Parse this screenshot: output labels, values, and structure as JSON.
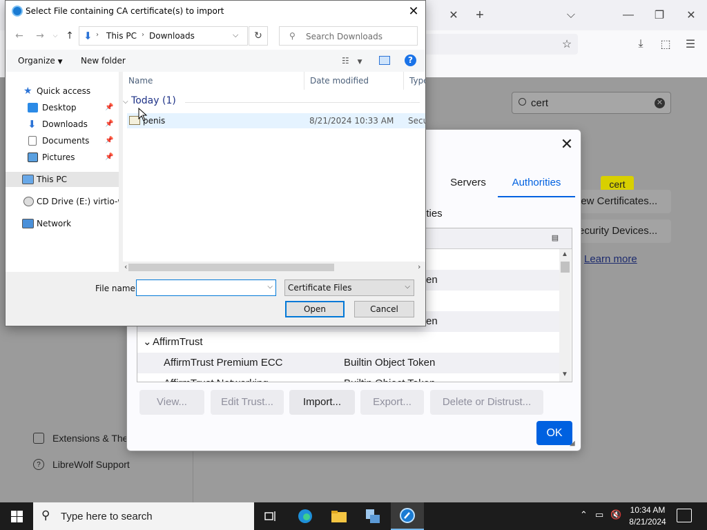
{
  "browser": {
    "prefs_search_value": "cert",
    "highlight_text": "cert",
    "view_certificates_label": "iew Certificates...",
    "security_devices_label": "ecurity Devices...",
    "learn_more": "Learn more",
    "sidebar_extensions": "Extensions & The",
    "sidebar_support": "LibreWolf Support"
  },
  "cert_manager": {
    "tabs": [
      "Servers",
      "Authorities"
    ],
    "active_tab": "Authorities",
    "subtitle": "ities",
    "rows": [
      {
        "col2": ""
      },
      {
        "col2": "en"
      },
      {
        "col2": ""
      },
      {
        "col2": "en"
      }
    ],
    "group": "AffirmTrust",
    "cert_row": {
      "name": "AffirmTrust Premium ECC",
      "token": "Builtin Object Token"
    },
    "cut_row": {
      "name": "AffirmTrust Networking",
      "token": "Builtin Object Token"
    },
    "buttons": {
      "view": "View...",
      "edit_trust": "Edit Trust...",
      "import": "Import...",
      "export": "Export...",
      "delete": "Delete or Distrust..."
    },
    "ok": "OK"
  },
  "file_dialog": {
    "title": "Select File containing CA certificate(s) to import",
    "breadcrumb": [
      "This PC",
      "Downloads"
    ],
    "search_placeholder": "Search Downloads",
    "organize": "Organize",
    "new_folder": "New folder",
    "nav": {
      "quick_access": "Quick access",
      "desktop": "Desktop",
      "downloads": "Downloads",
      "documents": "Documents",
      "pictures": "Pictures",
      "this_pc": "This PC",
      "cd_drive": "CD Drive (E:) virtio-w",
      "network": "Network"
    },
    "columns": {
      "name": "Name",
      "date": "Date modified",
      "type": "Type"
    },
    "group": "Today (1)",
    "file": {
      "name": "penis",
      "date": "8/21/2024 10:33 AM",
      "type": "Security Certificate"
    },
    "file_name_label": "File name:",
    "file_name_value": "",
    "filter": "Certificate Files",
    "open": "Open",
    "cancel": "Cancel"
  },
  "taskbar": {
    "search_placeholder": "Type here to search",
    "time": "10:34 AM",
    "date": "8/21/2024"
  },
  "colors": {
    "accent": "#0061e0",
    "win_blue": "#0078d7",
    "highlight": "#d8d000"
  }
}
